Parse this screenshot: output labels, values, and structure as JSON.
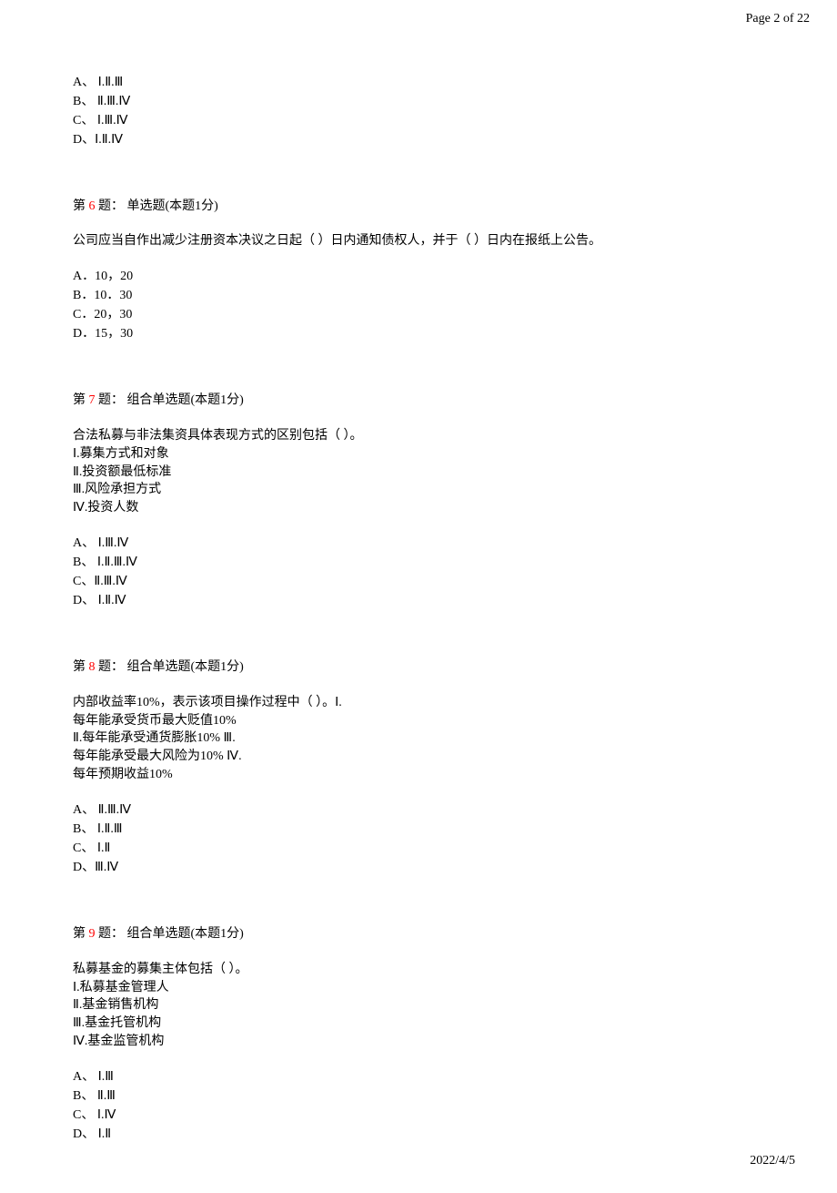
{
  "header": {
    "page_label": "Page 2 of 22"
  },
  "footer": {
    "date": "2022/4/5"
  },
  "top_options": [
    "A、 Ⅰ.Ⅱ.Ⅲ",
    "B、 Ⅱ.Ⅲ.Ⅳ",
    "C、 Ⅰ.Ⅲ.Ⅳ",
    "D、Ⅰ.Ⅱ.Ⅳ"
  ],
  "q6": {
    "prefix": "第 ",
    "num": "6",
    "suffix": " 题： 单选题(本题1分)",
    "stem": "公司应当自作出减少注册资本决议之日起（  ）日内通知债权人，并于（  ）日内在报纸上公告。",
    "opts": [
      "A．10，20",
      "B．10．30",
      "C．20，30",
      "D．15，30"
    ]
  },
  "q7": {
    "prefix": "第 ",
    "num": "7",
    "suffix": " 题： 组合单选题(本题1分)",
    "stem_lines": [
      "合法私募与非法集资具体表现方式的区别包括（  ）。",
      "Ⅰ.募集方式和对象",
      "Ⅱ.投资额最低标准",
      "Ⅲ.风险承担方式",
      "Ⅳ.投资人数"
    ],
    "opts": [
      "A、 Ⅰ.Ⅲ.Ⅳ",
      "B、 Ⅰ.Ⅱ.Ⅲ.Ⅳ",
      "C、Ⅱ.Ⅲ.Ⅳ",
      "D、 Ⅰ.Ⅱ.Ⅳ"
    ]
  },
  "q8": {
    "prefix": "第 ",
    "num": "8",
    "suffix": " 题： 组合单选题(本题1分)",
    "stem_lines": [
      "内部收益率10%，表示该项目操作过程中（  ）。Ⅰ.",
      "每年能承受货币最大贬值10%",
      "Ⅱ.每年能承受通货膨胀10% Ⅲ.",
      "每年能承受最大风险为10% Ⅳ.",
      "每年预期收益10%"
    ],
    "opts": [
      "A、 Ⅱ.Ⅲ.Ⅳ",
      "B、 Ⅰ.Ⅱ.Ⅲ",
      "C、 Ⅰ.Ⅱ",
      "D、Ⅲ.Ⅳ"
    ]
  },
  "q9": {
    "prefix": "第 ",
    "num": "9",
    "suffix": " 题： 组合单选题(本题1分)",
    "stem_lines": [
      "私募基金的募集主体包括（  ）。",
      "Ⅰ.私募基金管理人",
      "Ⅱ.基金销售机构",
      "Ⅲ.基金托管机构",
      "Ⅳ.基金监管机构"
    ],
    "opts": [
      "A、 Ⅰ.Ⅲ",
      "B、 Ⅱ.Ⅲ",
      "C、 Ⅰ.Ⅳ",
      "D、 Ⅰ.Ⅱ"
    ]
  }
}
